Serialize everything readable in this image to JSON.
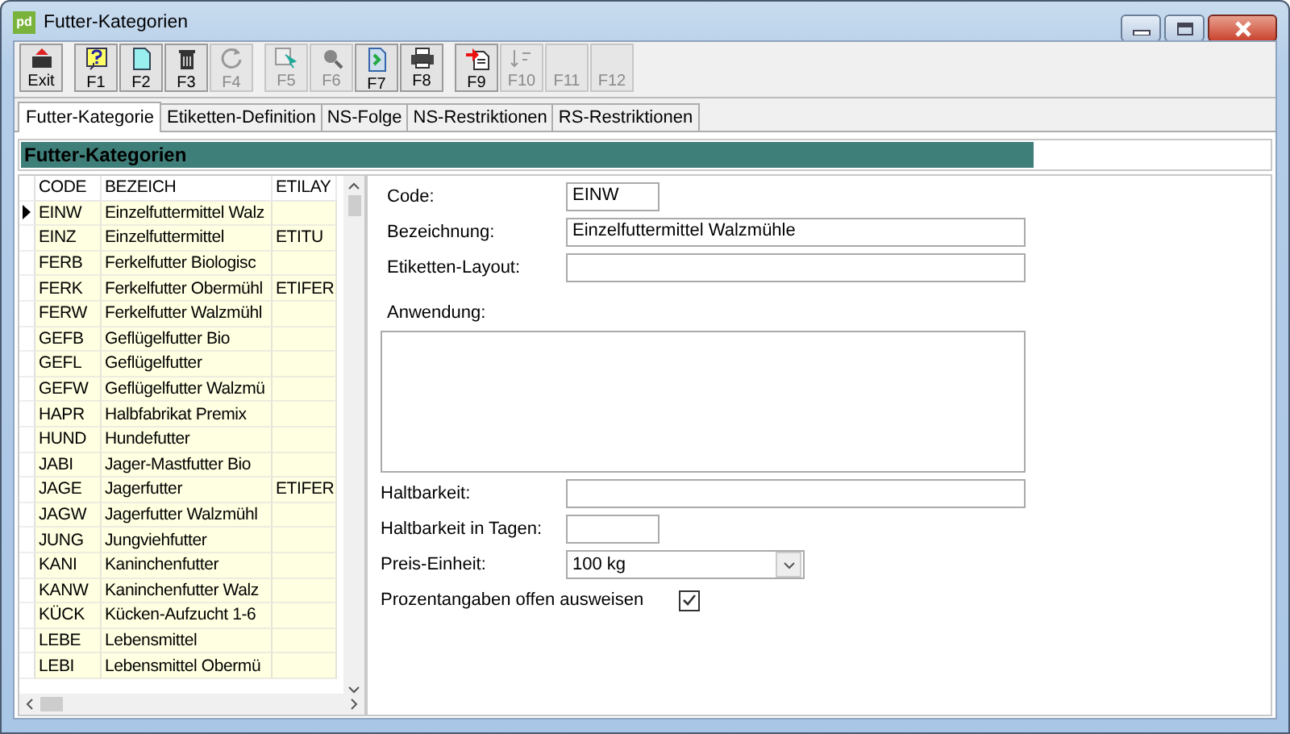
{
  "window": {
    "title": "Futter-Kategorien",
    "app_icon": "pd"
  },
  "toolbar": [
    {
      "label": "Exit",
      "disabled": false
    },
    {
      "label": "F1",
      "disabled": false
    },
    {
      "label": "F2",
      "disabled": false
    },
    {
      "label": "F3",
      "disabled": false
    },
    {
      "label": "F4",
      "disabled": true
    },
    {
      "label": "F5",
      "disabled": true
    },
    {
      "label": "F6",
      "disabled": true
    },
    {
      "label": "F7",
      "disabled": false
    },
    {
      "label": "F8",
      "disabled": false
    },
    {
      "label": "F9",
      "disabled": false
    },
    {
      "label": "F10",
      "disabled": true
    },
    {
      "label": "F11",
      "disabled": true
    },
    {
      "label": "F12",
      "disabled": true
    }
  ],
  "tabs": [
    {
      "label": "Futter-Kategorie",
      "selected": true
    },
    {
      "label": "Etiketten-Definition",
      "selected": false
    },
    {
      "label": "NS-Folge",
      "selected": false
    },
    {
      "label": "NS-Restriktionen",
      "selected": false
    },
    {
      "label": "RS-Restriktionen",
      "selected": false
    }
  ],
  "section_title": "Futter-Kategorien",
  "table": {
    "columns": [
      "CODE",
      "BEZEICH",
      "ETILAY"
    ],
    "rows": [
      {
        "cells": [
          "EINW",
          "Einzelfuttermittel Walz",
          ""
        ],
        "selected": true
      },
      {
        "cells": [
          "EINZ",
          "Einzelfuttermittel",
          "ETITU"
        ],
        "selected": false
      },
      {
        "cells": [
          "FERB",
          "Ferkelfutter Biologisc",
          ""
        ],
        "selected": false
      },
      {
        "cells": [
          "FERK",
          "Ferkelfutter Obermühl",
          "ETIFER"
        ],
        "selected": false
      },
      {
        "cells": [
          "FERW",
          "Ferkelfutter Walzmühl",
          ""
        ],
        "selected": false
      },
      {
        "cells": [
          "GEFB",
          "Geflügelfutter Bio",
          ""
        ],
        "selected": false
      },
      {
        "cells": [
          "GEFL",
          "Geflügelfutter",
          ""
        ],
        "selected": false
      },
      {
        "cells": [
          "GEFW",
          "Geflügelfutter Walzmü",
          ""
        ],
        "selected": false
      },
      {
        "cells": [
          "HAPR",
          "Halbfabrikat Premix",
          ""
        ],
        "selected": false
      },
      {
        "cells": [
          "HUND",
          "Hundefutter",
          ""
        ],
        "selected": false
      },
      {
        "cells": [
          "JABI",
          "Jager-Mastfutter Bio",
          ""
        ],
        "selected": false
      },
      {
        "cells": [
          "JAGE",
          "Jagerfutter",
          "ETIFER"
        ],
        "selected": false
      },
      {
        "cells": [
          "JAGW",
          "Jagerfutter Walzmühl",
          ""
        ],
        "selected": false
      },
      {
        "cells": [
          "JUNG",
          "Jungviehfutter",
          ""
        ],
        "selected": false
      },
      {
        "cells": [
          "KANI",
          "Kaninchenfutter",
          ""
        ],
        "selected": false
      },
      {
        "cells": [
          "KANW",
          "Kaninchenfutter Walz",
          ""
        ],
        "selected": false
      },
      {
        "cells": [
          "KÜCK",
          "Kücken-Aufzucht 1-6",
          ""
        ],
        "selected": false
      },
      {
        "cells": [
          "LEBE",
          "Lebensmittel",
          ""
        ],
        "selected": false
      },
      {
        "cells": [
          "LEBI",
          "Lebensmittel Obermü",
          ""
        ],
        "selected": false
      }
    ]
  },
  "form": {
    "code": {
      "label": "Code:",
      "value": "EINW"
    },
    "bezeichnung": {
      "label": "Bezeichnung:",
      "value": "Einzelfuttermittel Walzmühle"
    },
    "etiketten_layout": {
      "label": "Etiketten-Layout:"
    },
    "anwendung": {
      "label": "Anwendung:"
    },
    "haltbarkeit": {
      "label": "Haltbarkeit:"
    },
    "haltbarkeit_tage": {
      "label": "Haltbarkeit in Tagen:"
    },
    "preis_einheit": {
      "label": "Preis-Einheit:",
      "value": "100 kg"
    },
    "prozentangaben": {
      "label": "Prozentangaben offen ausweisen",
      "checked": true
    }
  }
}
